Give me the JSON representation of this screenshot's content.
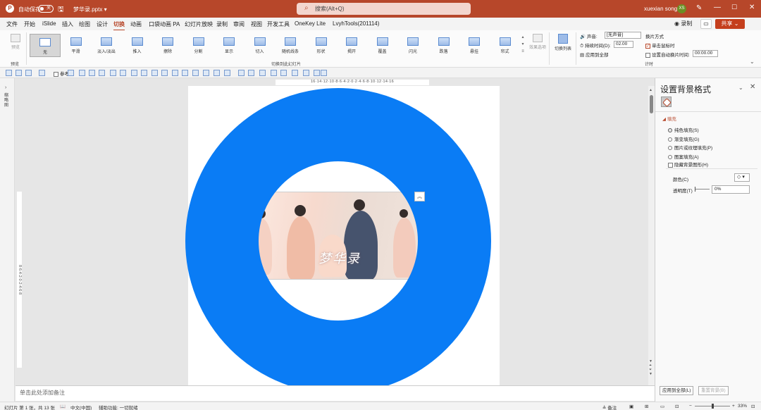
{
  "titlebar": {
    "autosave_label": "自动保存",
    "autosave_state": "关",
    "filename": "梦华录.pptx ▾",
    "search_placeholder": "搜索(Alt+Q)",
    "user_name": "xuexian song",
    "user_initials": "XS"
  },
  "menu": {
    "items": [
      "文件",
      "开始",
      "iSlide",
      "插入",
      "绘图",
      "设计",
      "切换",
      "动画",
      "口袋动画 PA",
      "幻灯片放映",
      "录制",
      "审阅",
      "视图",
      "开发工具",
      "OneKey Lite",
      "LvyhTools(201114)"
    ],
    "active": "切换",
    "record_label": "◉ 录制",
    "share_label": "共享 ⌄"
  },
  "ribbon": {
    "preview_label": "预览",
    "preview_group": "预览",
    "transitions": [
      "无",
      "平滑",
      "淡入/淡出",
      "推入",
      "擦除",
      "分割",
      "显示",
      "切入",
      "随机线条",
      "形状",
      "揭开",
      "覆盖",
      "闪光",
      "跌落",
      "悬挂",
      "帘式"
    ],
    "selected_transition": "无",
    "transitions_group": "切换到此幻灯片",
    "effect_options_label": "效果选项",
    "transition_list_label": "切换列表",
    "sound_label": "声音:",
    "sound_value": "[无声音]",
    "duration_label": "持续时间(D):",
    "duration_value": "02.00",
    "apply_all_label": "应用到全部",
    "advance_label": "换片方式",
    "on_click_label": "单击鼠标时",
    "after_label": "设置自动换片时间:",
    "after_value": "00:00.00",
    "timing_group": "计时"
  },
  "toolbar2": {
    "guides_label": "参考线"
  },
  "ruler": {
    "horizontal": "16·14·12·10·8·6·4·2·0·2·4·6·8·10·12·14·16",
    "vertical": "8·6·4·2·0·2·4·6·8"
  },
  "leftrail": {
    "label": "缩略图"
  },
  "slide": {
    "image_title": "梦华录",
    "ring_color": "#0a7cf5"
  },
  "notes": {
    "placeholder": "单击此处添加备注"
  },
  "pane": {
    "title": "设置背景格式",
    "section": "填充",
    "fill_options": [
      "纯色填充(S)",
      "渐变填充(G)",
      "图片或纹理填充(P)",
      "图案填充(A)"
    ],
    "selected_fill": "纯色填充(S)",
    "hide_bg_graphics": "隐藏背景图形(H)",
    "color_label": "颜色(C)",
    "transparency_label": "透明度(T)",
    "transparency_value": "0%",
    "apply_all_button": "应用到全部(L)",
    "reset_button": "重置背景(B)"
  },
  "status": {
    "slide_info": "幻灯片 第 1 张，共 13 张",
    "language": "中文(中国)",
    "accessibility": "辅助功能: 一切就绪",
    "notes_label": "备注",
    "zoom": "33%"
  },
  "colors": {
    "accent": "#b7472a",
    "share": "#c43e1c",
    "ring": "#0a7cf5"
  }
}
